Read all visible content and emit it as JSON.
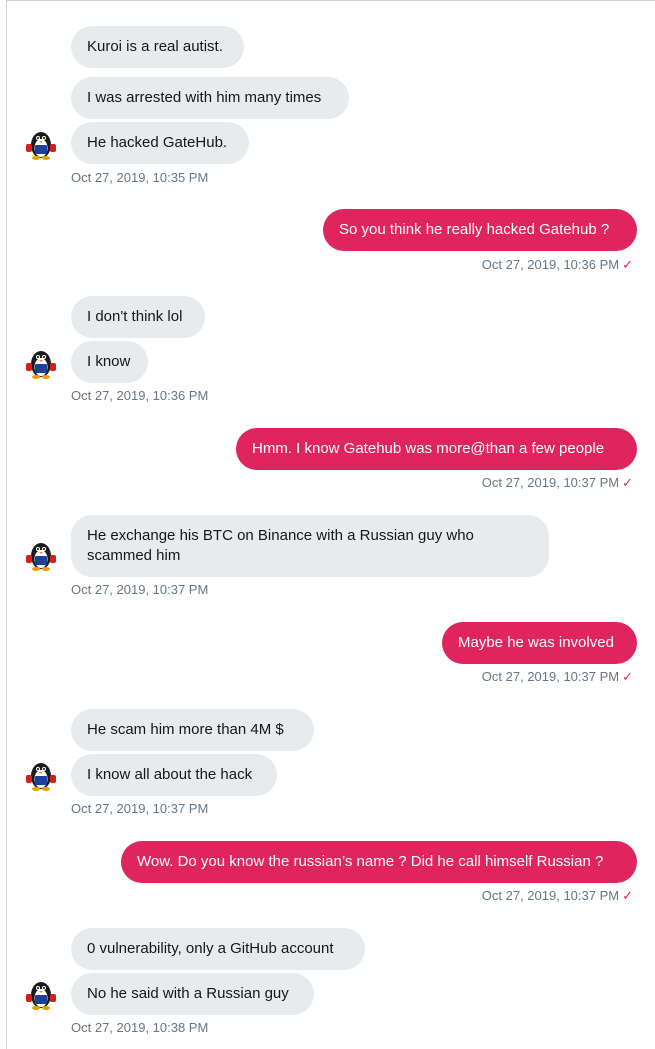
{
  "groups": [
    {
      "messages": [
        "Kuroi is a real autist.",
        "I was arrested with him many times",
        "He hacked GateHub."
      ],
      "timestamp": "Oct 27, 2019, 10:35 PM"
    },
    {
      "messages": [
        "I don't think lol",
        "I know"
      ],
      "timestamp": "Oct 27, 2019, 10:36 PM"
    },
    {
      "messages": [
        "He exchange his BTC on Binance with a Russian guy who scammed him"
      ],
      "timestamp": "Oct 27, 2019, 10:37 PM"
    },
    {
      "messages": [
        "He scam him more than 4M $",
        "I know all about the hack"
      ],
      "timestamp": "Oct 27, 2019, 10:37 PM"
    },
    {
      "messages": [
        "0 vulnerability, only a GitHub account",
        "No he said with a Russian guy"
      ],
      "timestamp": "Oct 27, 2019, 10:38 PM"
    }
  ],
  "sent": [
    {
      "text": "So you think he really hacked Gatehub ?",
      "timestamp": "Oct 27, 2019, 10:36 PM"
    },
    {
      "text": "Hmm. I know Gatehub was more@than a few people",
      "timestamp": "Oct 27, 2019, 10:37 PM"
    },
    {
      "text": "Maybe he was involved",
      "timestamp": "Oct 27, 2019, 10:37 PM"
    },
    {
      "text": "Wow. Do you know the russian’s name ? Did he call himself Russian ?",
      "timestamp": "Oct 27, 2019, 10:37 PM"
    }
  ],
  "read_mark": "✓",
  "avatar_icon": "penguin-avatar-icon",
  "colors": {
    "sent_bubble": "#e0245e",
    "received_bubble": "#e8ebee",
    "timestamp": "#657786"
  }
}
